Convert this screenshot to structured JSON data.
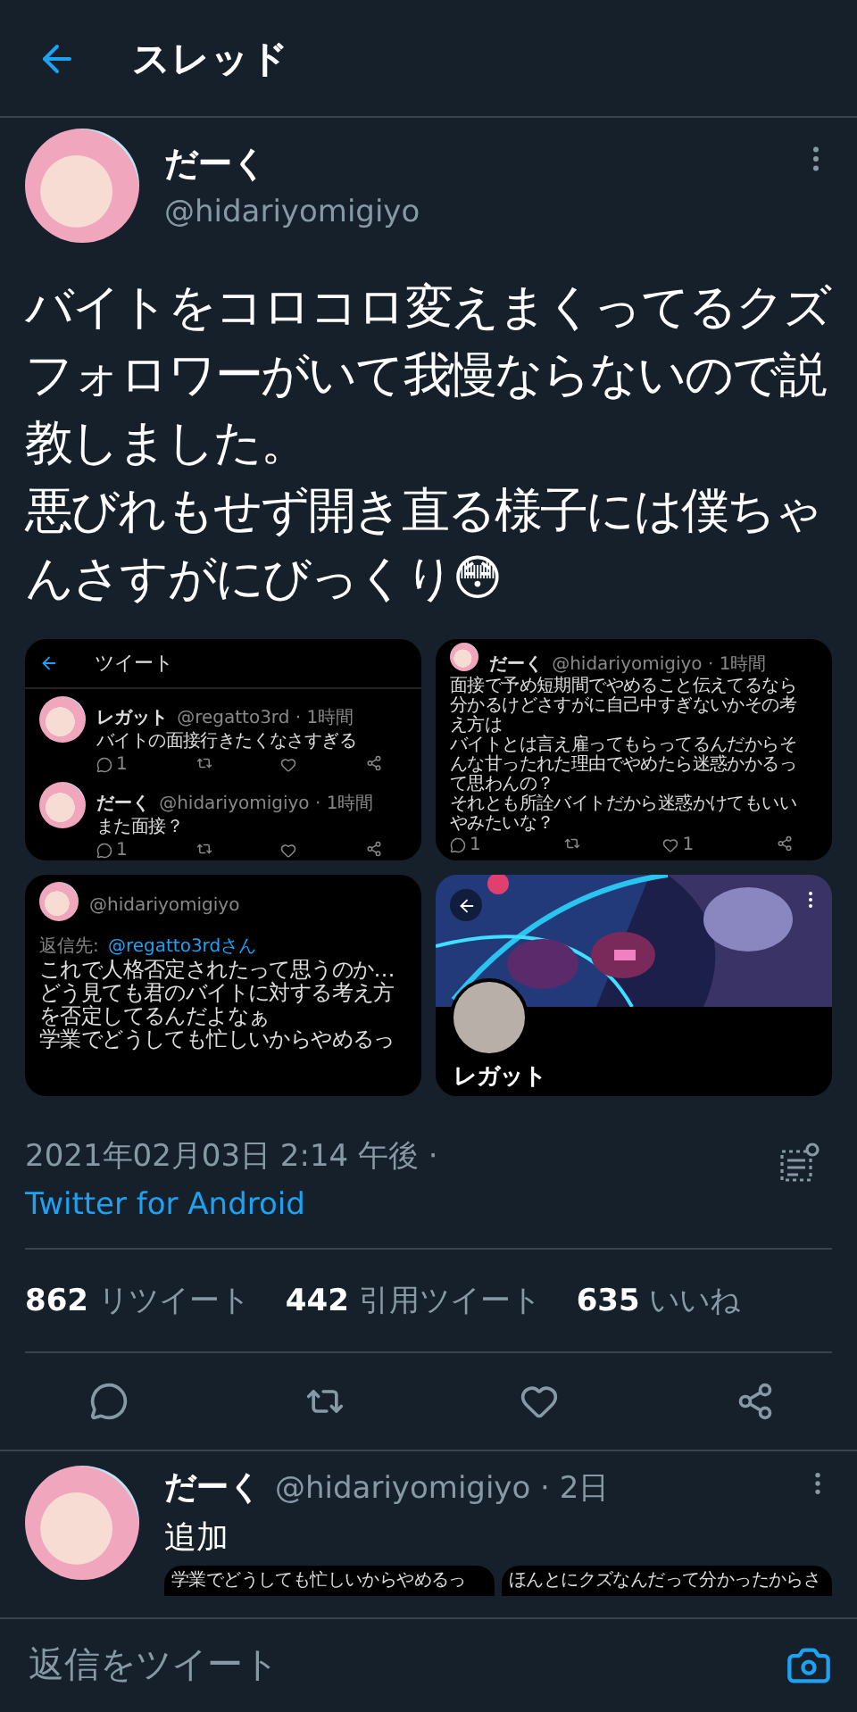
{
  "header": {
    "title": "スレッド"
  },
  "tweet": {
    "name": "だーく",
    "handle": "@hidariyomigiyo",
    "paragraphs": [
      "バイトをコロコロ変えまくってるクズフォロワーがいて我慢ならないので説教しました。",
      "悪びれもせず開き直る様子には僕ちゃんさすがにびっくり😳"
    ],
    "images": [
      {
        "kind": "thread",
        "title": "ツイート",
        "tweets": [
          {
            "name": "レガット",
            "meta": "@regatto3rd · 1時間",
            "text": "バイトの面接行きたくなさすぎる",
            "replies": "1"
          },
          {
            "name": "だーく",
            "meta": "@hidariyomigiyo · 1時間",
            "text": "また面接？",
            "replies": "1"
          }
        ]
      },
      {
        "kind": "tweet",
        "name": "だーく",
        "meta": "@hidariyomigiyo · 1時間",
        "lines": [
          "面接で予め短期間でやめること伝えてるなら",
          "分かるけどさすがに自己中すぎないかその考",
          "え方は",
          "バイトとは言え雇ってもらってるんだからそ",
          "んな甘ったれた理由でやめたら迷惑かかるっ",
          "て思わんの？",
          "それとも所詮バイトだから迷惑かけてもいい",
          "やみたいな？"
        ],
        "replies": "1",
        "likes": "1"
      },
      {
        "kind": "reply",
        "meta": "@hidariyomigiyo",
        "reply_label": "返信先:",
        "reply_target": "@regatto3rdさん",
        "lines": [
          "これで人格否定されたって思うのか…",
          "どう見ても君のバイトに対する考え方",
          "を否定してるんだよなぁ",
          "学業でどうしても忙しいからやめるっ"
        ]
      },
      {
        "kind": "profile",
        "name": "レガット"
      }
    ],
    "timestamp": "2021年02月03日 2:14 午後 ·",
    "source": "Twitter for Android",
    "stats": [
      {
        "count": "862",
        "label": "リツイート"
      },
      {
        "count": "442",
        "label": "引用ツイート"
      },
      {
        "count": "635",
        "label": "いいね"
      }
    ]
  },
  "reply": {
    "name": "だーく",
    "meta": "@hidariyomigiyo · 2日",
    "text": "追加",
    "snippets": [
      "学業でどうしても忙しいからやめるっ",
      "ほんとにクズなんだって分かったからさ"
    ]
  },
  "composer": {
    "placeholder": "返信をツイート"
  }
}
